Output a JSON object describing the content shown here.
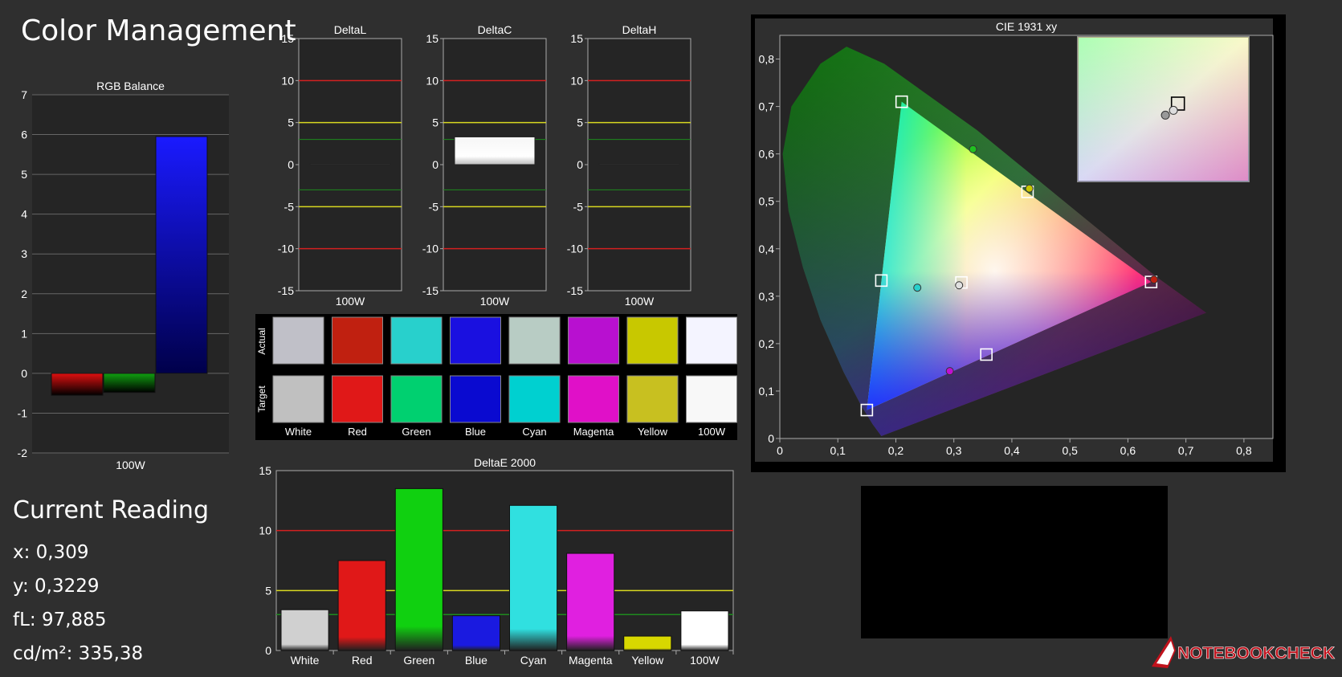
{
  "page": {
    "title": "Color Management"
  },
  "reading": {
    "title": "Current Reading",
    "x": "x: 0,309",
    "y": "y: 0,3229",
    "fl": "fL: 97,885",
    "cdm2": "cd/m²: 335,38"
  },
  "watermark": "NOTEBOOKCHECK",
  "swatch_labels": {
    "actual": "Actual",
    "target": "Target"
  },
  "colors": {
    "panel_bg": "#252525",
    "grid": "#666666",
    "red_line": "#d42020",
    "yellow_line": "#d8d820",
    "green_line": "#1e8a1e"
  },
  "chart_data": [
    {
      "id": "rgb",
      "type": "bar",
      "title": "RGB Balance",
      "categories": [
        "100W"
      ],
      "series": [
        {
          "values": [
            -0.55
          ],
          "color": "#e01010"
        },
        {
          "values": [
            -0.48
          ],
          "color": "#10a010"
        },
        {
          "values": [
            5.95
          ],
          "color": "#1a1aff"
        }
      ],
      "ylim": [
        -2,
        7
      ],
      "yticks": [
        "-2",
        "-1",
        "0",
        "1",
        "2",
        "3",
        "4",
        "5",
        "6",
        "7"
      ],
      "grid": true
    },
    {
      "id": "deltaL",
      "type": "bar",
      "title": "DeltaL",
      "categories": [
        "100W"
      ],
      "values": [
        0.1
      ],
      "ylim": [
        -15,
        15
      ],
      "yticks": [
        "-15",
        "-10",
        "-5",
        "0",
        "5",
        "10",
        "15"
      ],
      "thresholds": [
        10,
        -10,
        5,
        -5,
        3,
        -3
      ]
    },
    {
      "id": "deltaC",
      "type": "bar",
      "title": "DeltaC",
      "categories": [
        "100W"
      ],
      "values": [
        3.3
      ],
      "ylim": [
        -15,
        15
      ],
      "yticks": [
        "-15",
        "-10",
        "-5",
        "0",
        "5",
        "10",
        "15"
      ],
      "thresholds": [
        10,
        -10,
        5,
        -5,
        3,
        -3
      ]
    },
    {
      "id": "deltaH",
      "type": "bar",
      "title": "DeltaH",
      "categories": [
        "100W"
      ],
      "values": [
        0.1
      ],
      "ylim": [
        -15,
        15
      ],
      "yticks": [
        "-15",
        "-10",
        "-5",
        "0",
        "5",
        "10",
        "15"
      ],
      "thresholds": [
        10,
        -10,
        5,
        -5,
        3,
        -3
      ]
    },
    {
      "id": "swatches",
      "type": "table",
      "categories": [
        "White",
        "Red",
        "Green",
        "Blue",
        "Cyan",
        "Magenta",
        "Yellow",
        "100W"
      ],
      "actual": [
        "#c0c0c8",
        "#c02010",
        "#28d0cc",
        "#1a10e0",
        "#b8ccc4",
        "#b810d0",
        "#c8c800",
        "#f4f4ff"
      ],
      "target": [
        "#c0c0c0",
        "#e01818",
        "#00d070",
        "#0a0ad0",
        "#00d0d0",
        "#e010c8",
        "#c8c020",
        "#f8f8f8"
      ]
    },
    {
      "id": "deltaE",
      "type": "bar",
      "title": "DeltaE 2000",
      "categories": [
        "White",
        "Red",
        "Green",
        "Blue",
        "Cyan",
        "Magenta",
        "Yellow",
        "100W"
      ],
      "values": [
        3.4,
        7.5,
        13.5,
        2.9,
        12.1,
        8.1,
        1.2,
        3.3
      ],
      "colors": [
        "#d0d0d0",
        "#e01818",
        "#10d010",
        "#1a1ae0",
        "#30e0e0",
        "#e020e0",
        "#d8d800",
        "#ffffff"
      ],
      "ylim": [
        0,
        15
      ],
      "yticks": [
        "0",
        "5",
        "10",
        "15"
      ],
      "thresholds": [
        10,
        5,
        3
      ]
    },
    {
      "id": "cie",
      "type": "scatter",
      "title": "CIE 1931 xy",
      "xlim": [
        0,
        0.85
      ],
      "ylim": [
        0,
        0.85
      ],
      "xticks": [
        "0",
        "0,1",
        "0,2",
        "0,3",
        "0,4",
        "0,5",
        "0,6",
        "0,7",
        "0,8"
      ],
      "yticks": [
        "0",
        "0,1",
        "0,2",
        "0,3",
        "0,4",
        "0,5",
        "0,6",
        "0,7",
        "0,8"
      ],
      "targets": [
        {
          "x": 0.21,
          "y": 0.71
        },
        {
          "x": 0.427,
          "y": 0.52
        },
        {
          "x": 0.64,
          "y": 0.33
        },
        {
          "x": 0.356,
          "y": 0.177
        },
        {
          "x": 0.15,
          "y": 0.06
        },
        {
          "x": 0.175,
          "y": 0.333
        },
        {
          "x": 0.313,
          "y": 0.329
        }
      ],
      "measured": [
        {
          "x": 0.333,
          "y": 0.61,
          "color": "#20c020"
        },
        {
          "x": 0.43,
          "y": 0.527,
          "color": "#c8c800"
        },
        {
          "x": 0.645,
          "y": 0.335,
          "color": "#c02010"
        },
        {
          "x": 0.293,
          "y": 0.142,
          "color": "#c010d0"
        },
        {
          "x": 0.237,
          "y": 0.318,
          "color": "#28d0cc"
        },
        {
          "x": 0.309,
          "y": 0.323,
          "color": "#e0e0e0"
        }
      ]
    }
  ]
}
